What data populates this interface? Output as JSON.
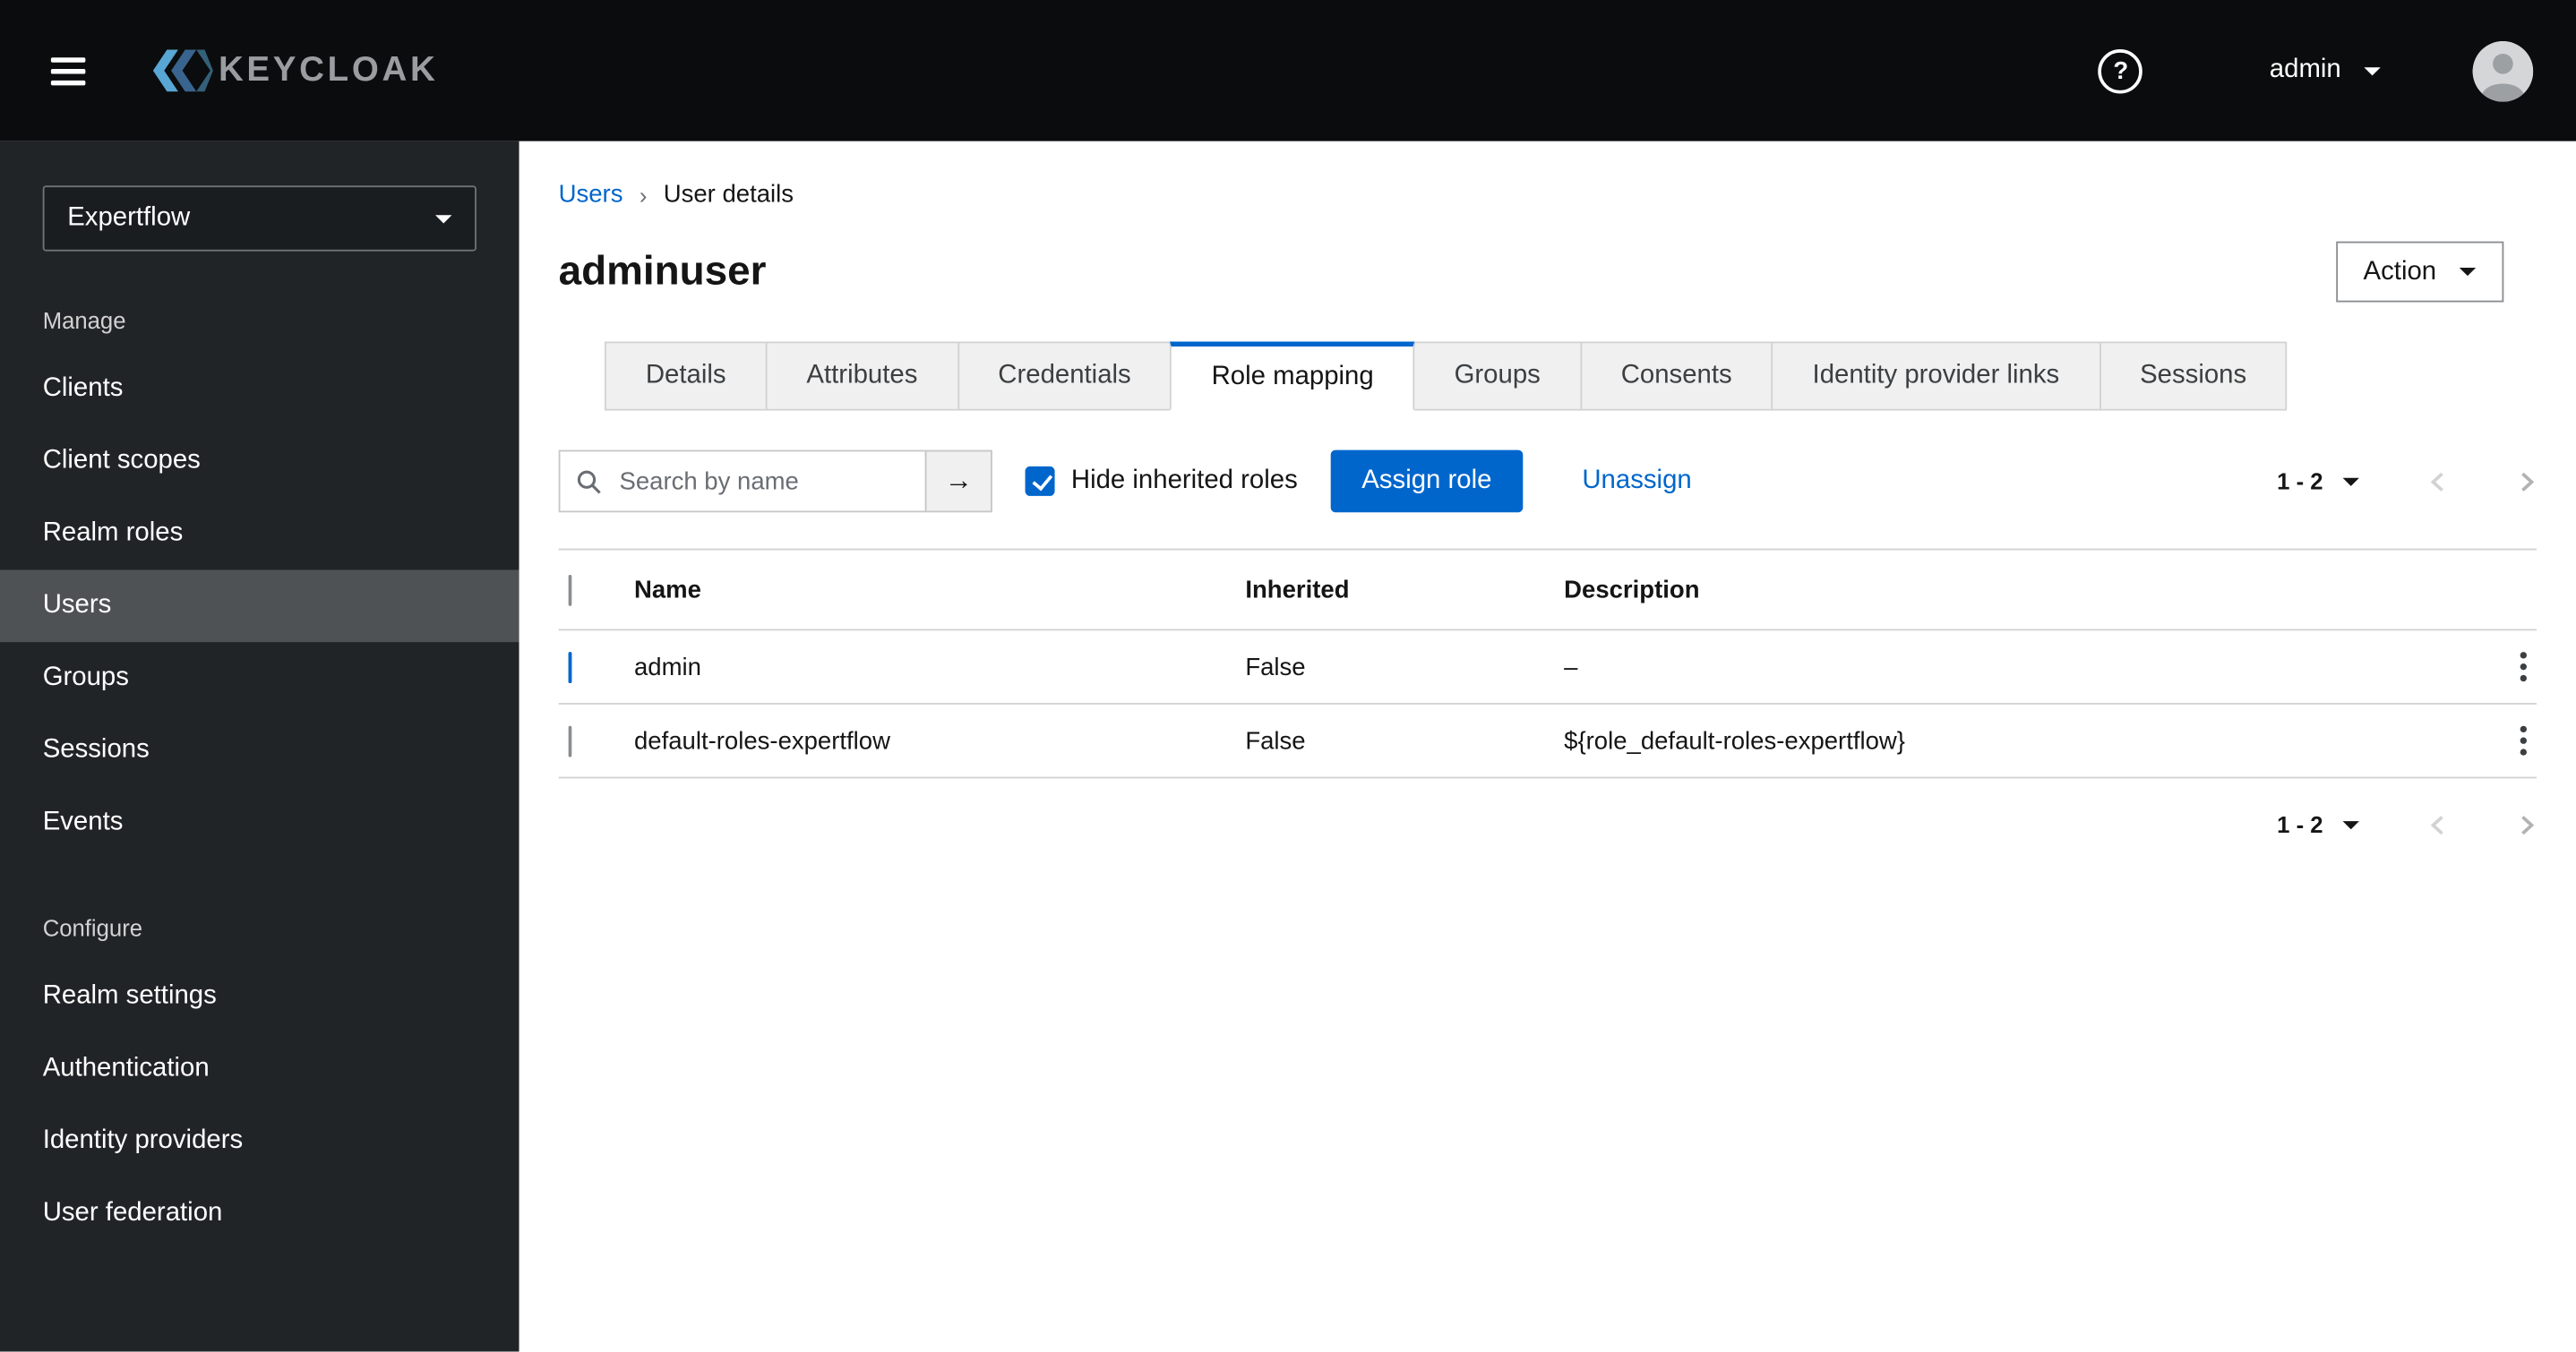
{
  "masthead": {
    "brand_text": "KEYCLOAK",
    "help_icon": "?",
    "user": "admin"
  },
  "sidebar": {
    "realm_selector": {
      "value": "Expertflow"
    },
    "selected_item": "Users",
    "sections": [
      {
        "title": "Manage",
        "items": [
          {
            "label": "Clients"
          },
          {
            "label": "Client scopes"
          },
          {
            "label": "Realm roles"
          },
          {
            "label": "Users",
            "current": true
          },
          {
            "label": "Groups"
          },
          {
            "label": "Sessions"
          },
          {
            "label": "Events"
          }
        ]
      },
      {
        "title": "Configure",
        "items": [
          {
            "label": "Realm settings"
          },
          {
            "label": "Authentication"
          },
          {
            "label": "Identity providers"
          },
          {
            "label": "User federation"
          }
        ]
      }
    ]
  },
  "breadcrumb": {
    "items": [
      "Users",
      "User details"
    ],
    "separator": "›"
  },
  "page": {
    "title": "adminuser",
    "action_button": "Action"
  },
  "tabs": {
    "active": "Role mapping",
    "items": [
      "Details",
      "Attributes",
      "Credentials",
      "Role mapping",
      "Groups",
      "Consents",
      "Identity provider links",
      "Sessions"
    ]
  },
  "toolbar": {
    "search": {
      "placeholder": "Search by name",
      "value": "",
      "submit_icon": "→"
    },
    "hide_inherited": {
      "label": "Hide inherited roles",
      "checked": true
    },
    "assign_button": "Assign role",
    "unassign_link": "Unassign"
  },
  "pagination": {
    "range": "1 - 2"
  },
  "table": {
    "select_all_checked": false,
    "headers": {
      "name": "Name",
      "inherited": "Inherited",
      "description": "Description"
    },
    "rows": [
      {
        "checked": true,
        "name": "admin",
        "inherited": "False",
        "description": "–"
      },
      {
        "checked": false,
        "name": "default-roles-expertflow",
        "inherited": "False",
        "description": "${role_default-roles-expertflow}"
      }
    ]
  }
}
